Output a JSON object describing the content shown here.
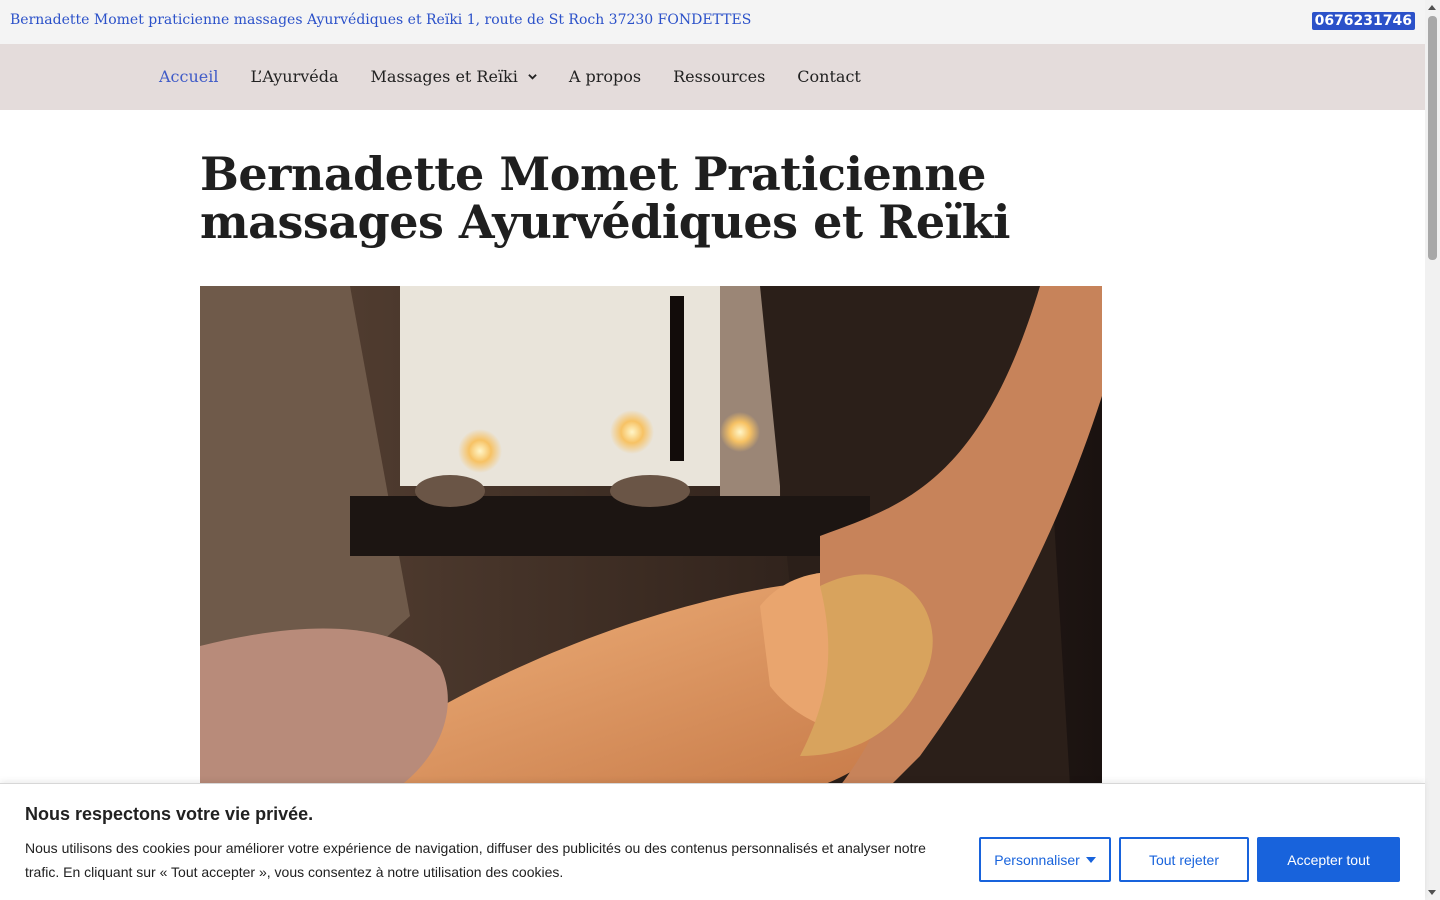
{
  "topbar": {
    "address": "Bernadette Momet praticienne massages Ayurvédiques et Reïki 1, route de St Roch 37230 FONDETTES",
    "phone": "0676231746"
  },
  "nav": {
    "items": [
      {
        "label": "Accueil",
        "active": true
      },
      {
        "label": "L’Ayurvéda"
      },
      {
        "label": "Massages et Reïki",
        "has_dropdown": true
      },
      {
        "label": "A propos"
      },
      {
        "label": "Ressources"
      },
      {
        "label": "Contact"
      }
    ]
  },
  "main": {
    "title": "Bernadette Momet Praticienne massages Ayurvédiques et Reïki",
    "hero_image": "massage-photo"
  },
  "cookie": {
    "title": "Nous respectons votre vie privée.",
    "text": "Nous utilisons des cookies pour améliorer votre expérience de navigation, diffuser des publicités ou des contenus personnalisés et analyser notre trafic. En cliquant sur « Tout accepter », vous consentez à notre utilisation des cookies.",
    "customize_label": "Personnaliser",
    "reject_label": "Tout rejeter",
    "accept_label": "Accepter tout"
  },
  "colors": {
    "accent": "#2b51c9",
    "nav_bg": "#e4dcdb",
    "cookie_button": "#1863dc"
  }
}
